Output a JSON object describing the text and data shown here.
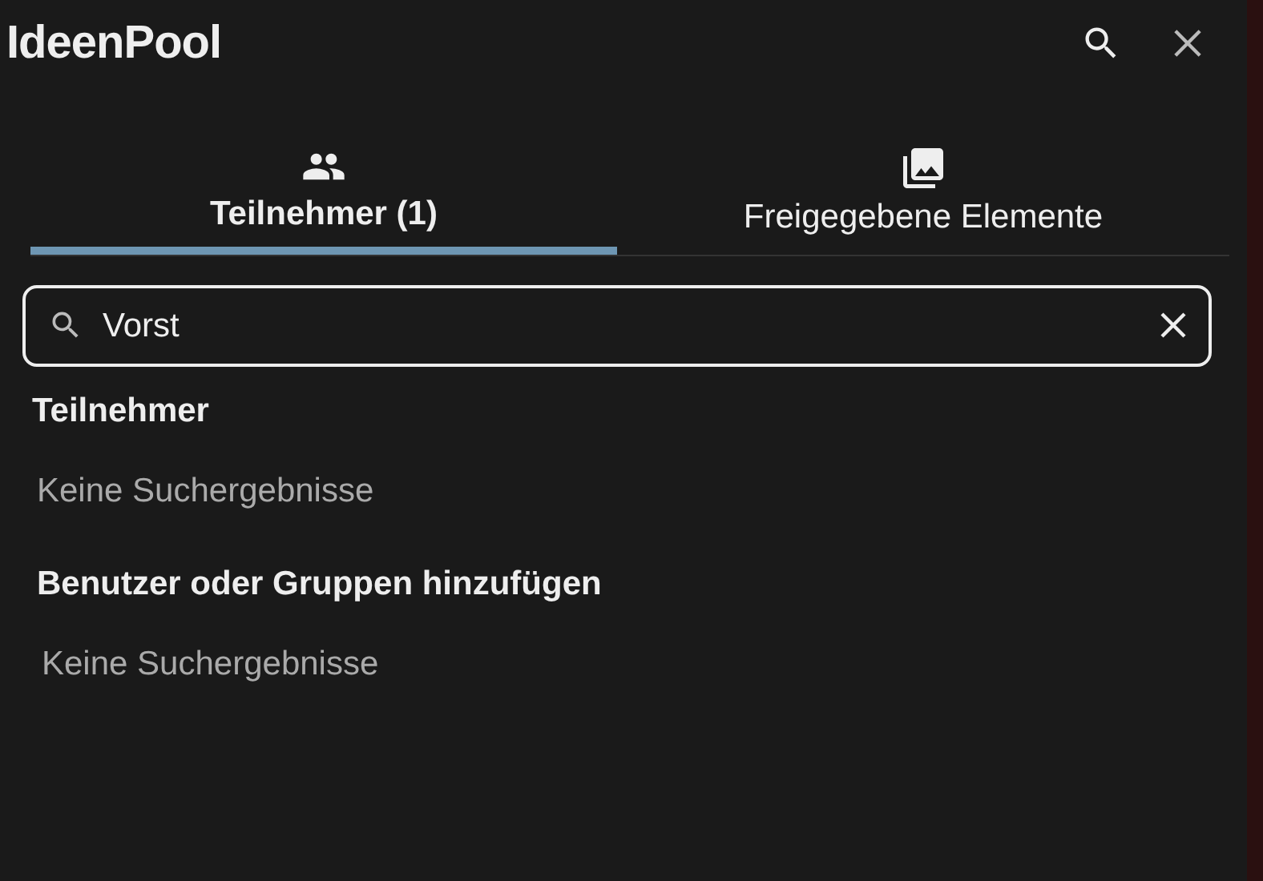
{
  "header": {
    "title": "IdeenPool"
  },
  "tabs": [
    {
      "label": "Teilnehmer (1)",
      "selected": true
    },
    {
      "label": "Freigegebene Elemente",
      "selected": false
    }
  ],
  "search": {
    "value": "Vorst"
  },
  "sections": [
    {
      "heading": "Teilnehmer",
      "empty_text": "Keine Suchergebnisse"
    },
    {
      "heading": "Benutzer oder Gruppen hinzufügen",
      "empty_text": "Keine Suchergebnisse"
    }
  ]
}
